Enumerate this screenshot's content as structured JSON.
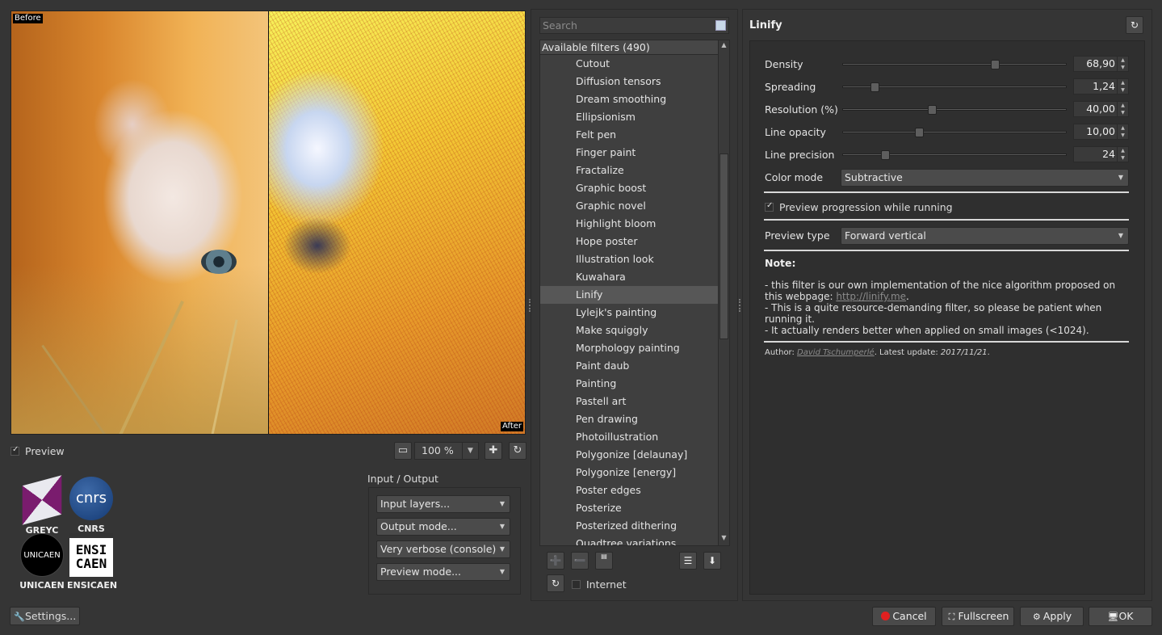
{
  "preview": {
    "before_label": "Before",
    "after_label": "After",
    "toggle_label": "Preview",
    "zoom_value": "100 %"
  },
  "logos": {
    "greyc": "GREYC",
    "cnrs": "CNRS",
    "cnrs_mark": "cnrs",
    "unicaen": "UNICAEN",
    "unicaen_mark": "UNICAEN",
    "ensicaen": "ENSICAEN",
    "ensicaen_mark_1": "ENSI",
    "ensicaen_mark_2": "CAEN"
  },
  "io": {
    "title": "Input / Output",
    "input_layers": "Input layers...",
    "output_mode": "Output mode...",
    "verbosity": "Very verbose (console)",
    "preview_mode": "Preview mode..."
  },
  "settings_label": "Settings...",
  "filters": {
    "search_placeholder": "Search",
    "header": "Available filters (490)",
    "items": [
      "Cutout",
      "Diffusion tensors",
      "Dream smoothing",
      "Ellipsionism",
      "Felt pen",
      "Finger paint",
      "Fractalize",
      "Graphic boost",
      "Graphic novel",
      "Highlight bloom",
      "Hope poster",
      "Illustration look",
      "Kuwahara",
      "Linify",
      "Lylejk's painting",
      "Make squiggly",
      "Morphology painting",
      "Paint daub",
      "Painting",
      "Pastell art",
      "Pen drawing",
      "Photoillustration",
      "Polygonize [delaunay]",
      "Polygonize [energy]",
      "Poster edges",
      "Posterize",
      "Posterized dithering",
      "Quadtree variations"
    ],
    "selected": "Linify",
    "internet_label": "Internet"
  },
  "params": {
    "filter_name": "Linify",
    "sliders": [
      {
        "label": "Density",
        "value": "68,90",
        "fraction": 0.68
      },
      {
        "label": "Spreading",
        "value": "1,24",
        "fraction": 0.14
      },
      {
        "label": "Resolution (%)",
        "value": "40,00",
        "fraction": 0.4
      },
      {
        "label": "Line opacity",
        "value": "10,00",
        "fraction": 0.34
      },
      {
        "label": "Line precision",
        "value": "24",
        "fraction": 0.19
      }
    ],
    "color_mode_label": "Color mode",
    "color_mode_value": "Subtractive",
    "progression_label": "Preview progression while running",
    "preview_type_label": "Preview type",
    "preview_type_value": "Forward vertical",
    "note_title": "Note:",
    "note_line1_a": "- this filter is our own implementation of the nice algorithm proposed on this webpage: ",
    "note_link": "http://linify.me",
    "note_line1_b": ".",
    "note_line2": "- This is a quite resource-demanding filter, so please be patient when running it.",
    "note_line3": "- It actually renders better when applied on small images (<1024).",
    "author_prefix": "Author: ",
    "author_name": "David Tschumperlé",
    "update_prefix": ". Latest update: ",
    "update_date": "2017/11/21",
    "update_suffix": "."
  },
  "buttons": {
    "cancel": "Cancel",
    "fullscreen": "Fullscreen",
    "apply": "Apply",
    "ok": "OK"
  },
  "colors": {
    "background": "#353535",
    "cancel_dot": "#e02020"
  }
}
